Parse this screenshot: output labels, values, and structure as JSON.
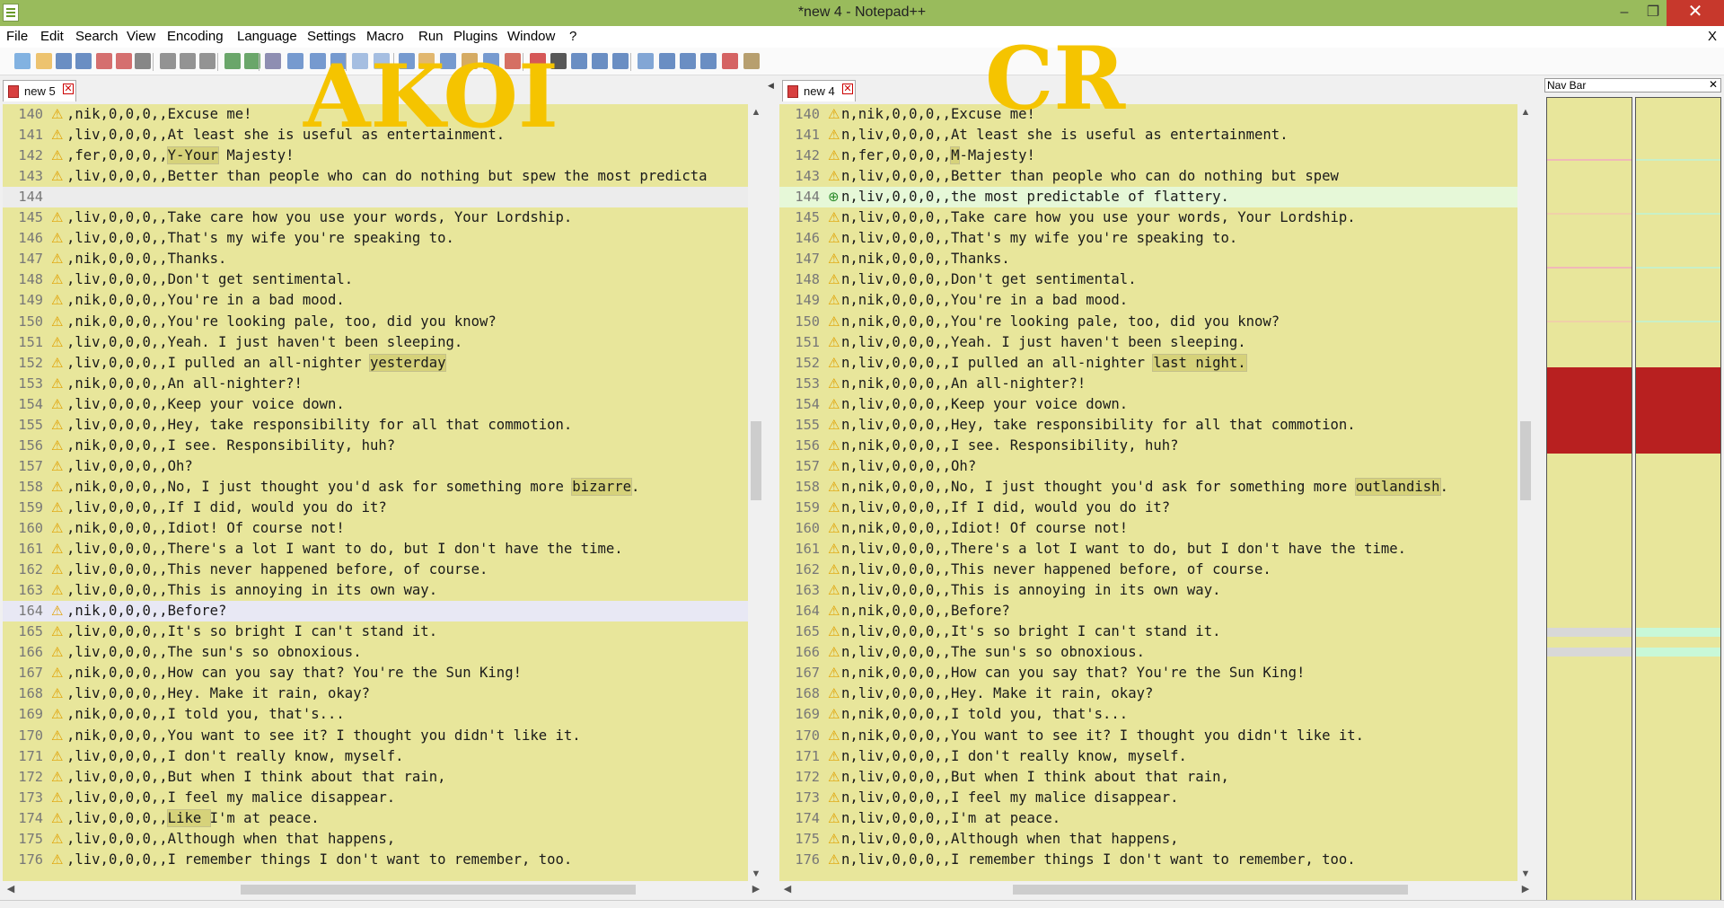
{
  "window": {
    "title": "*new  4 - Notepad++",
    "minimize": "–",
    "maximize": "❐",
    "close": "✕"
  },
  "menu": {
    "items": [
      "File",
      "Edit",
      "Search",
      "View",
      "Encoding",
      "Language",
      "Settings",
      "Macro",
      "Run",
      "Plugins",
      "Window",
      "?"
    ],
    "close": "X"
  },
  "toolbar": {
    "icons": [
      "new-file-icon",
      "open-file-icon",
      "save-icon",
      "save-all-icon",
      "close-icon",
      "close-all-icon",
      "print-icon",
      "cut-icon",
      "copy-icon",
      "paste-icon",
      "undo-icon",
      "redo-icon",
      "find-icon",
      "replace-icon",
      "zoom-in-icon",
      "zoom-out-icon",
      "sync-vertical-icon",
      "sync-horizontal-icon",
      "word-wrap-icon",
      "all-chars-icon",
      "indent-guide-icon",
      "udl-icon",
      "doc-map-icon",
      "function-list-icon",
      "record-macro-icon",
      "stop-record-icon",
      "play-macro-icon",
      "run-macro-multiple-icon",
      "save-macro-icon",
      "compare-icon",
      "prev-diff-icon",
      "next-diff-icon",
      "last-diff-icon",
      "spell-check-icon",
      "settings-icon"
    ]
  },
  "watermarks": {
    "left": "AKOI",
    "right": "CR"
  },
  "left_pane": {
    "tab": {
      "label": "new 5",
      "close": "✕"
    },
    "cursor_line": 164,
    "lines": [
      {
        "n": "140",
        "m": "warn",
        "t": ",nik,0,0,0,,Excuse me!"
      },
      {
        "n": "141",
        "m": "warn",
        "t": ",liv,0,0,0,,At least she is useful as entertainment."
      },
      {
        "n": "142",
        "m": "warn",
        "t": ",fer,0,0,0,,",
        "h": "Y-Your",
        "t2": " Majesty!"
      },
      {
        "n": "143",
        "m": "warn",
        "t": ",liv,0,0,0,,Better than people who can do nothing but spew the most predicta"
      },
      {
        "n": "144",
        "m": "",
        "t": "",
        "blank": true
      },
      {
        "n": "145",
        "m": "warn",
        "t": ",liv,0,0,0,,Take care how you use your words, Your Lordship."
      },
      {
        "n": "146",
        "m": "warn",
        "t": ",liv,0,0,0,,That's my wife you're speaking to."
      },
      {
        "n": "147",
        "m": "warn",
        "t": ",nik,0,0,0,,Thanks."
      },
      {
        "n": "148",
        "m": "warn",
        "t": ",liv,0,0,0,,Don't get sentimental."
      },
      {
        "n": "149",
        "m": "warn",
        "t": ",nik,0,0,0,,You're in a bad mood."
      },
      {
        "n": "150",
        "m": "warn",
        "t": ",nik,0,0,0,,You're looking pale, too, did you know?"
      },
      {
        "n": "151",
        "m": "warn",
        "t": ",liv,0,0,0,,Yeah. I just haven't been sleeping."
      },
      {
        "n": "152",
        "m": "warn",
        "t": ",liv,0,0,0,,I pulled an all-nighter ",
        "h": "yesterday",
        "t2": ""
      },
      {
        "n": "153",
        "m": "warn",
        "t": ",nik,0,0,0,,An all-nighter?!"
      },
      {
        "n": "154",
        "m": "warn",
        "t": ",liv,0,0,0,,Keep your voice down."
      },
      {
        "n": "155",
        "m": "warn",
        "t": ",liv,0,0,0,,Hey, take responsibility for all that commotion."
      },
      {
        "n": "156",
        "m": "warn",
        "t": ",nik,0,0,0,,I see. Responsibility, huh?"
      },
      {
        "n": "157",
        "m": "warn",
        "t": ",liv,0,0,0,,Oh?"
      },
      {
        "n": "158",
        "m": "warn",
        "t": ",nik,0,0,0,,No, I just thought you'd ask for something more ",
        "h": "bizarre",
        "t2": "."
      },
      {
        "n": "159",
        "m": "warn",
        "t": ",liv,0,0,0,,If I did, would you do it?"
      },
      {
        "n": "160",
        "m": "warn",
        "t": ",nik,0,0,0,,Idiot! Of course not!"
      },
      {
        "n": "161",
        "m": "warn",
        "t": ",liv,0,0,0,,There's a lot I want to do, but I don't have the time."
      },
      {
        "n": "162",
        "m": "warn",
        "t": ",liv,0,0,0,,This never happened before, of course."
      },
      {
        "n": "163",
        "m": "warn",
        "t": ",liv,0,0,0,,This is annoying in its own way."
      },
      {
        "n": "164",
        "m": "warn",
        "t": ",nik,0,0,0,,Before?"
      },
      {
        "n": "165",
        "m": "warn",
        "t": ",liv,0,0,0,,It's so bright I can't stand it."
      },
      {
        "n": "166",
        "m": "warn",
        "t": ",liv,0,0,0,,The sun's so obnoxious."
      },
      {
        "n": "167",
        "m": "warn",
        "t": ",nik,0,0,0,,How can you say that? You're the Sun King!"
      },
      {
        "n": "168",
        "m": "warn",
        "t": ",liv,0,0,0,,Hey. Make it rain, okay?"
      },
      {
        "n": "169",
        "m": "warn",
        "t": ",nik,0,0,0,,I told you, that's..."
      },
      {
        "n": "170",
        "m": "warn",
        "t": ",nik,0,0,0,,You want to see it? I thought you didn't like it."
      },
      {
        "n": "171",
        "m": "warn",
        "t": ",liv,0,0,0,,I don't really know, myself."
      },
      {
        "n": "172",
        "m": "warn",
        "t": ",liv,0,0,0,,But when I think about that rain,"
      },
      {
        "n": "173",
        "m": "warn",
        "t": ",liv,0,0,0,,I feel my malice disappear."
      },
      {
        "n": "174",
        "m": "warn",
        "t": ",liv,0,0,0,,",
        "h": "Like ",
        "t2": "I'm at peace."
      },
      {
        "n": "175",
        "m": "warn",
        "t": ",liv,0,0,0,,Although when that happens,"
      },
      {
        "n": "176",
        "m": "warn",
        "t": ",liv,0,0,0,,I remember things I don't want to remember, too."
      }
    ]
  },
  "right_pane": {
    "tab": {
      "label": "new 4",
      "close": "✕"
    },
    "lines": [
      {
        "n": "140",
        "m": "warn",
        "t": "n,nik,0,0,0,,Excuse me!"
      },
      {
        "n": "141",
        "m": "warn",
        "t": "n,liv,0,0,0,,At least she is useful as entertainment."
      },
      {
        "n": "142",
        "m": "warn",
        "t": "n,fer,0,0,0,,",
        "h": "M",
        "t2": "-Majesty!"
      },
      {
        "n": "143",
        "m": "warn",
        "t": "n,liv,0,0,0,,Better than people who can do nothing but spew"
      },
      {
        "n": "144",
        "m": "add",
        "t": "n,liv,0,0,0,,the most predictable of flattery.",
        "added": true
      },
      {
        "n": "145",
        "m": "warn",
        "t": "n,liv,0,0,0,,Take care how you use your words, Your Lordship."
      },
      {
        "n": "146",
        "m": "warn",
        "t": "n,liv,0,0,0,,That's my wife you're speaking to."
      },
      {
        "n": "147",
        "m": "warn",
        "t": "n,nik,0,0,0,,Thanks."
      },
      {
        "n": "148",
        "m": "warn",
        "t": "n,liv,0,0,0,,Don't get sentimental."
      },
      {
        "n": "149",
        "m": "warn",
        "t": "n,nik,0,0,0,,You're in a bad mood."
      },
      {
        "n": "150",
        "m": "warn",
        "t": "n,nik,0,0,0,,You're looking pale, too, did you know?"
      },
      {
        "n": "151",
        "m": "warn",
        "t": "n,liv,0,0,0,,Yeah. I just haven't been sleeping."
      },
      {
        "n": "152",
        "m": "warn",
        "t": "n,liv,0,0,0,,I pulled an all-nighter ",
        "h": "last night.",
        "t2": ""
      },
      {
        "n": "153",
        "m": "warn",
        "t": "n,nik,0,0,0,,An all-nighter?!"
      },
      {
        "n": "154",
        "m": "warn",
        "t": "n,liv,0,0,0,,Keep your voice down."
      },
      {
        "n": "155",
        "m": "warn",
        "t": "n,liv,0,0,0,,Hey, take responsibility for all that commotion."
      },
      {
        "n": "156",
        "m": "warn",
        "t": "n,nik,0,0,0,,I see. Responsibility, huh?"
      },
      {
        "n": "157",
        "m": "warn",
        "t": "n,liv,0,0,0,,Oh?"
      },
      {
        "n": "158",
        "m": "warn",
        "t": "n,nik,0,0,0,,No, I just thought you'd ask for something more ",
        "h": "outlandish",
        "t2": "."
      },
      {
        "n": "159",
        "m": "warn",
        "t": "n,liv,0,0,0,,If I did, would you do it?"
      },
      {
        "n": "160",
        "m": "warn",
        "t": "n,nik,0,0,0,,Idiot! Of course not!"
      },
      {
        "n": "161",
        "m": "warn",
        "t": "n,liv,0,0,0,,There's a lot I want to do, but I don't have the time."
      },
      {
        "n": "162",
        "m": "warn",
        "t": "n,liv,0,0,0,,This never happened before, of course."
      },
      {
        "n": "163",
        "m": "warn",
        "t": "n,liv,0,0,0,,This is annoying in its own way."
      },
      {
        "n": "164",
        "m": "warn",
        "t": "n,nik,0,0,0,,Before?"
      },
      {
        "n": "165",
        "m": "warn",
        "t": "n,liv,0,0,0,,It's so bright I can't stand it."
      },
      {
        "n": "166",
        "m": "warn",
        "t": "n,liv,0,0,0,,The sun's so obnoxious."
      },
      {
        "n": "167",
        "m": "warn",
        "t": "n,nik,0,0,0,,How can you say that? You're the Sun King!"
      },
      {
        "n": "168",
        "m": "warn",
        "t": "n,liv,0,0,0,,Hey. Make it rain, okay?"
      },
      {
        "n": "169",
        "m": "warn",
        "t": "n,nik,0,0,0,,I told you, that's..."
      },
      {
        "n": "170",
        "m": "warn",
        "t": "n,nik,0,0,0,,You want to see it? I thought you didn't like it."
      },
      {
        "n": "171",
        "m": "warn",
        "t": "n,liv,0,0,0,,I don't really know, myself."
      },
      {
        "n": "172",
        "m": "warn",
        "t": "n,liv,0,0,0,,But when I think about that rain,"
      },
      {
        "n": "173",
        "m": "warn",
        "t": "n,liv,0,0,0,,I feel my malice disappear."
      },
      {
        "n": "174",
        "m": "warn",
        "t": "n,liv,0,0,0,,I'm at peace."
      },
      {
        "n": "175",
        "m": "warn",
        "t": "n,liv,0,0,0,,Although when that happens,"
      },
      {
        "n": "176",
        "m": "warn",
        "t": "n,liv,0,0,0,,I remember things I don't want to remember, too."
      }
    ]
  },
  "nav_bar": {
    "title": "Nav Bar",
    "close": "✕"
  },
  "colors": {
    "titlebar": "#99bb5c",
    "editor_bg": "#e8e69b",
    "diff_highlight": "#d6d27a",
    "added_line": "#e6f8d8",
    "cursor_line": "#e8e8f4",
    "blank_line": "#ececec",
    "watermark": "#f5c400"
  }
}
